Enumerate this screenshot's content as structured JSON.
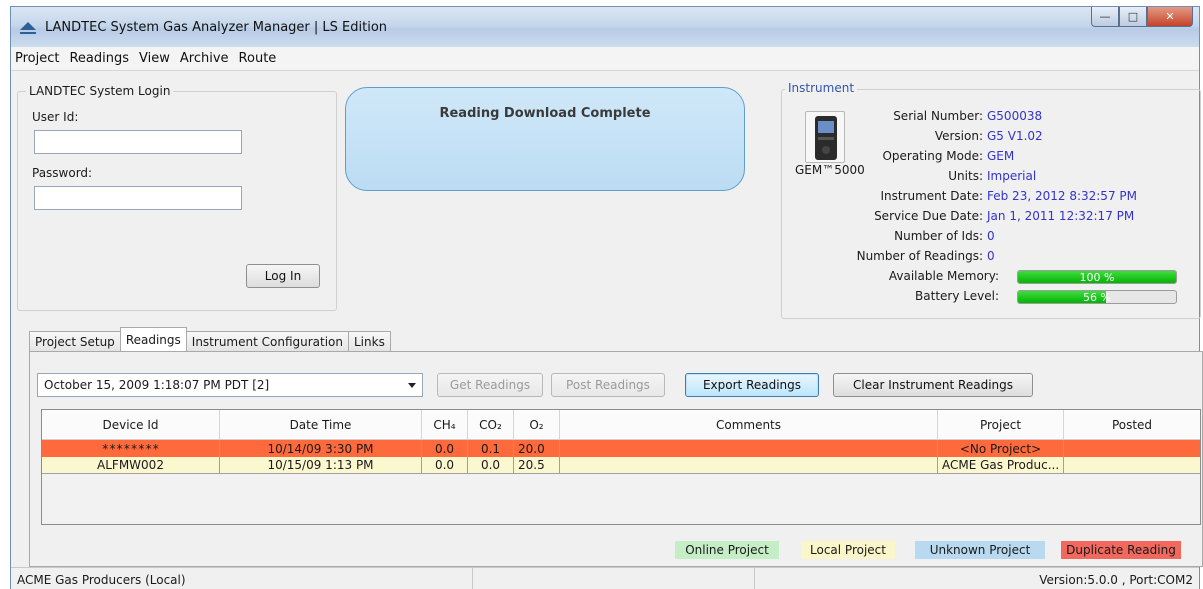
{
  "window": {
    "title": "LANDTEC System Gas Analyzer Manager | LS Edition"
  },
  "menu": [
    "Project",
    "Readings",
    "View",
    "Archive",
    "Route"
  ],
  "login": {
    "group_label": "LANDTEC System Login",
    "user_label": "User Id:",
    "user_value": "",
    "password_label": "Password:",
    "password_value": "",
    "login_button": "Log In"
  },
  "status": {
    "message": "Reading Download Complete"
  },
  "instrument": {
    "group_label": "Instrument",
    "device_name": "GEM™5000",
    "fields": [
      {
        "key": "Serial Number:",
        "value": "G500038"
      },
      {
        "key": "Version:",
        "value": "G5 V1.02"
      },
      {
        "key": "Operating Mode:",
        "value": "GEM"
      },
      {
        "key": "Units:",
        "value": "Imperial"
      },
      {
        "key": "Instrument Date:",
        "value": "Feb 23, 2012 8:32:57 PM"
      },
      {
        "key": "Service Due Date:",
        "value": "Jan 1, 2011 12:32:17 PM"
      },
      {
        "key": "Number of Ids:",
        "value": "0"
      },
      {
        "key": "Number of Readings:",
        "value": "0"
      }
    ],
    "memory_label": "Available Memory:",
    "memory_text": "100 %",
    "memory_percent": 100,
    "battery_label": "Battery Level:",
    "battery_text": "56 %",
    "battery_percent": 56
  },
  "tabs": [
    "Project Setup",
    "Readings",
    "Instrument Configuration",
    "Links"
  ],
  "selected_tab": "Readings",
  "readings": {
    "session_select": "October 15, 2009 1:18:07 PM PDT [2]",
    "buttons": {
      "get": "Get Readings",
      "post": "Post Readings",
      "export": "Export Readings",
      "clear": "Clear Instrument Readings"
    },
    "columns": [
      "Device Id",
      "Date Time",
      "CH₄",
      "CO₂",
      "O₂",
      "Comments",
      "Project",
      "Posted"
    ],
    "rows": [
      {
        "device_id": "********",
        "date_time": "10/14/09 3:30 PM",
        "ch4": "0.0",
        "co2": "0.1",
        "o2": "20.0",
        "comments": "",
        "project": "<No Project>",
        "posted": "",
        "kind": "duplicate"
      },
      {
        "device_id": "ALFMW002",
        "date_time": "10/15/09 1:13 PM",
        "ch4": "0.0",
        "co2": "0.0",
        "o2": "20.5",
        "comments": "",
        "project": "ACME Gas Produc...",
        "posted": "",
        "kind": "local"
      }
    ],
    "legend": [
      {
        "label": "Online Project",
        "color": "#c6eec6"
      },
      {
        "label": "Local Project",
        "color": "#fbf6c9"
      },
      {
        "label": "Unknown Project",
        "color": "#b8d9ef"
      },
      {
        "label": "Duplicate Reading",
        "color": "#f2685c"
      }
    ]
  },
  "statusbar": {
    "project": "ACME Gas Producers (Local)",
    "version": "Version:5.0.0 , Port:COM2"
  },
  "colors": {
    "duplicate_row": "#ff6a3d",
    "local_row": "#fbf7cf",
    "value_text": "#3333cc",
    "progress_green": "#10bf10"
  }
}
